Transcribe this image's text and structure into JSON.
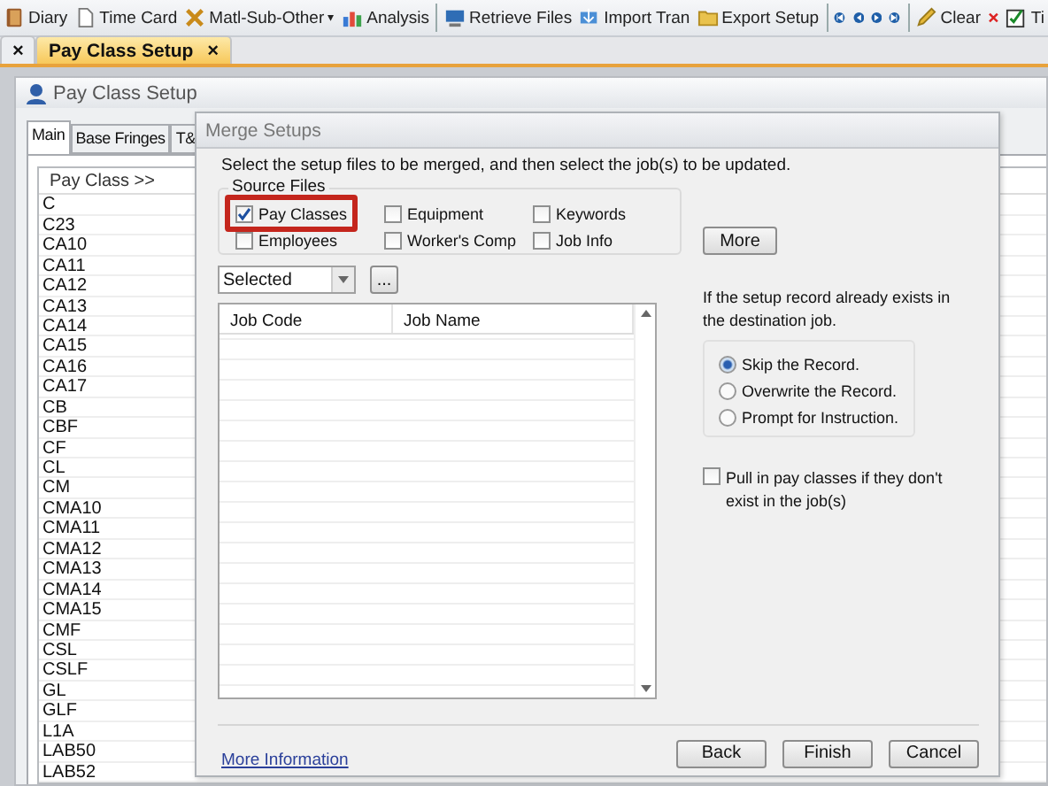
{
  "toolbar": {
    "items": [
      {
        "kind": "button",
        "label": "Diary"
      },
      {
        "kind": "button",
        "label": "Time Card"
      },
      {
        "kind": "menu",
        "label": "Matl-Sub-Other",
        "caret": "▾"
      },
      {
        "kind": "button",
        "label": "Analysis"
      },
      {
        "kind": "separator"
      },
      {
        "kind": "button",
        "label": "Retrieve Files"
      },
      {
        "kind": "button",
        "label": "Import Tran"
      },
      {
        "kind": "button",
        "label": "Export Setup"
      },
      {
        "kind": "separator"
      },
      {
        "kind": "icon"
      },
      {
        "kind": "icon"
      },
      {
        "kind": "icon"
      },
      {
        "kind": "icon"
      },
      {
        "kind": "separator"
      },
      {
        "kind": "button",
        "label": "Clear"
      },
      {
        "kind": "icon"
      },
      {
        "kind": "button",
        "label": "Ti"
      }
    ]
  },
  "document_tabs": [
    {
      "close": "×",
      "selected": false
    },
    {
      "label": "Pay Class Setup",
      "close": "×",
      "selected": true
    }
  ],
  "window": {
    "title": "Pay Class Setup",
    "tabs": [
      {
        "label": "Main",
        "selected": true
      },
      {
        "label": "Base Fringes",
        "selected": false
      },
      {
        "label": "T&",
        "selected": false
      }
    ],
    "list": {
      "header": "Pay Class >>",
      "rows": [
        "C",
        "C23",
        "CA10",
        "CA11",
        "CA12",
        "CA13",
        "CA14",
        "CA15",
        "CA16",
        "CA17",
        "CB",
        "CBF",
        "CF",
        "CL",
        "CM",
        "CMA10",
        "CMA11",
        "CMA12",
        "CMA13",
        "CMA14",
        "CMA15",
        "CMF",
        "CSL",
        "CSLF",
        "GL",
        "GLF",
        "L1A",
        "LAB50",
        "LAB52"
      ]
    }
  },
  "dialog": {
    "title": "Merge Setups",
    "instruction": "Select the setup files to be merged, and then select the job(s) to be updated.",
    "source_files": {
      "title": "Source Files",
      "options": [
        {
          "label": "Pay Classes",
          "checked": true,
          "highlighted": true
        },
        {
          "label": "Equipment",
          "checked": false,
          "highlighted": false
        },
        {
          "label": "Keywords",
          "checked": false,
          "highlighted": false
        },
        {
          "label": "Employees",
          "checked": false,
          "highlighted": false
        },
        {
          "label": "Worker's Comp",
          "checked": false,
          "highlighted": false
        },
        {
          "label": "Job Info",
          "checked": false,
          "highlighted": false
        }
      ]
    },
    "more_button": "More",
    "filter": {
      "value": "Selected"
    },
    "browse_button": "...",
    "table": {
      "columns": [
        "Job Code",
        "Job Name"
      ]
    },
    "conflict": {
      "prompt": "If the setup record already exists in the destination job.",
      "options": [
        {
          "label": "Skip the Record.",
          "selected": true
        },
        {
          "label": "Overwrite the Record.",
          "selected": false
        },
        {
          "label": "Prompt for Instruction.",
          "selected": false
        }
      ]
    },
    "pull_in": {
      "label": "Pull in pay classes if they don't exist in the job(s)",
      "checked": false
    },
    "link": "More Information",
    "buttons": [
      "Back",
      "Finish",
      "Cancel"
    ]
  }
}
